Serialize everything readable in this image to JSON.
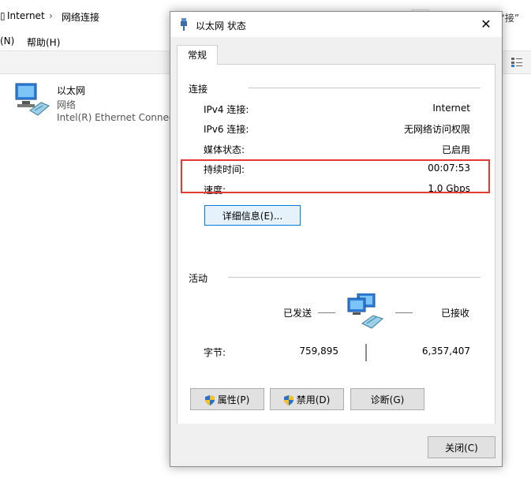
{
  "background": {
    "breadcrumb_internet": "Internet",
    "breadcrumb_sep": "›",
    "breadcrumb_current": "网络连接",
    "right_text": "‘接”",
    "menu_n": "(N)",
    "menu_help": "帮助(H)",
    "adapter": {
      "name": "以太网",
      "status": "网络",
      "device": "Intel(R) Ethernet Connect"
    }
  },
  "dialog": {
    "title": "以太网 状态",
    "close_glyph": "✕",
    "tab_general": "常规",
    "connection": {
      "header": "连接",
      "rows": [
        {
          "label": "IPv4 连接:",
          "value": "Internet"
        },
        {
          "label": "IPv6 连接:",
          "value": "无网络访问权限"
        },
        {
          "label": "媒体状态:",
          "value": "已启用"
        },
        {
          "label": "持续时间:",
          "value": "00:07:53"
        },
        {
          "label": "速度:",
          "value": "1.0 Gbps"
        }
      ],
      "details_button": "详细信息(E)..."
    },
    "activity": {
      "header": "活动",
      "sent_label": "已发送",
      "received_label": "已接收",
      "bytes_label": "字节:",
      "bytes_sent": "759,895",
      "bytes_received": "6,357,407"
    },
    "buttons": {
      "properties": "属性(P)",
      "disable": "禁用(D)",
      "diagnose": "诊断(G)",
      "close": "关闭(C)"
    }
  },
  "colors": {
    "highlight": "#e53935",
    "focus_border": "#0078d7",
    "dialog_bg": "#f0f0f0"
  }
}
